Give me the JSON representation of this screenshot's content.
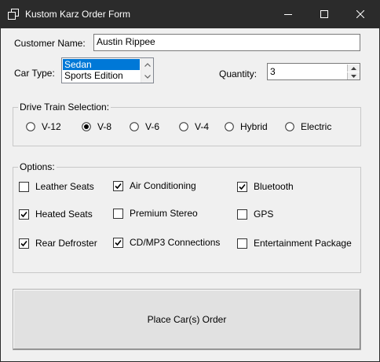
{
  "window": {
    "title": "Kustom Karz Order Form",
    "icon": "window-app-icon",
    "controls": [
      "minimize",
      "maximize",
      "close"
    ]
  },
  "customer": {
    "label": "Customer Name:",
    "value": "Austin Rippee"
  },
  "car_type": {
    "label": "Car Type:",
    "items": [
      "Sedan",
      "Sports Edition"
    ],
    "selected": "Sedan"
  },
  "quantity": {
    "label": "Quantity:",
    "value": "3"
  },
  "drive_train": {
    "caption": "Drive Train Selection:",
    "options": [
      {
        "label": "V-12",
        "checked": false
      },
      {
        "label": "V-8",
        "checked": true
      },
      {
        "label": "V-6",
        "checked": false
      },
      {
        "label": "V-4",
        "checked": false
      },
      {
        "label": "Hybrid",
        "checked": false
      },
      {
        "label": "Electric",
        "checked": false
      }
    ]
  },
  "options": {
    "caption": "Options:",
    "items": [
      {
        "label": "Leather Seats",
        "checked": false
      },
      {
        "label": "Air Conditioning",
        "checked": true
      },
      {
        "label": "Bluetooth",
        "checked": true
      },
      {
        "label": "Heated Seats",
        "checked": true
      },
      {
        "label": "Premium Stereo",
        "checked": false
      },
      {
        "label": "GPS",
        "checked": false
      },
      {
        "label": "Rear Defroster",
        "checked": true
      },
      {
        "label": "CD/MP3 Connections",
        "checked": true
      },
      {
        "label": "Entertainment Package",
        "checked": false
      }
    ]
  },
  "order_button": {
    "label": "Place Car(s) Order"
  },
  "colors": {
    "titlebar": "#2b2b2b",
    "client": "#f0f0f0",
    "selection": "#0078d7"
  }
}
